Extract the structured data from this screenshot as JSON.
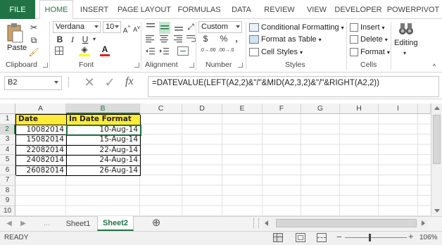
{
  "ribbon_tabs": {
    "file": "FILE",
    "items": [
      "HOME",
      "INSERT",
      "PAGE LAYOUT",
      "FORMULAS",
      "DATA",
      "REVIEW",
      "VIEW",
      "DEVELOPER",
      "POWERPIVOT"
    ],
    "active": "HOME"
  },
  "clipboard": {
    "paste_label": "Paste",
    "group_label": "Clipboard"
  },
  "font": {
    "family": "Verdana",
    "size": "10",
    "bold": "B",
    "italic": "I",
    "underline": "U",
    "group_label": "Font"
  },
  "alignment": {
    "group_label": "Alignment"
  },
  "number": {
    "format": "Custom",
    "currency": "$",
    "percent": "%",
    "comma": ",",
    "inc_decimal": ".0→.00",
    "dec_decimal": ".00→.0",
    "group_label": "Number"
  },
  "styles": {
    "conditional": "Conditional Formatting",
    "table": "Format as Table",
    "cell_styles": "Cell Styles",
    "group_label": "Styles"
  },
  "cells": {
    "insert": "Insert",
    "delete": "Delete",
    "format": "Format",
    "group_label": "Cells"
  },
  "editing": {
    "label": "Editing"
  },
  "formula_bar": {
    "name_box": "B2",
    "fx": "fx",
    "formula": "=DATEVALUE(LEFT(A2,2)&\"/\"&MID(A2,3,2)&\"/\"&RIGHT(A2,2))"
  },
  "grid": {
    "columns": [
      "A",
      "B",
      "C",
      "D",
      "E",
      "F",
      "G",
      "H",
      "I"
    ],
    "rows": [
      "1",
      "2",
      "3",
      "4",
      "5",
      "6",
      "7",
      "8",
      "9",
      "10"
    ],
    "headers": [
      "Date",
      "In Date Format"
    ],
    "data": [
      [
        "10082014",
        "10-Aug-14"
      ],
      [
        "15082014",
        "15-Aug-14"
      ],
      [
        "22082014",
        "22-Aug-14"
      ],
      [
        "24082014",
        "24-Aug-14"
      ],
      [
        "26082014",
        "26-Aug-14"
      ]
    ],
    "header_color": "#ffeb38"
  },
  "sheets": {
    "tabs": [
      "Sheet1",
      "Sheet2"
    ],
    "active": "Sheet2",
    "add": "⊕"
  },
  "status": {
    "ready": "READY",
    "zoom": "106%",
    "minus": "−",
    "plus": "+"
  },
  "colors": {
    "accent": "#217346"
  }
}
